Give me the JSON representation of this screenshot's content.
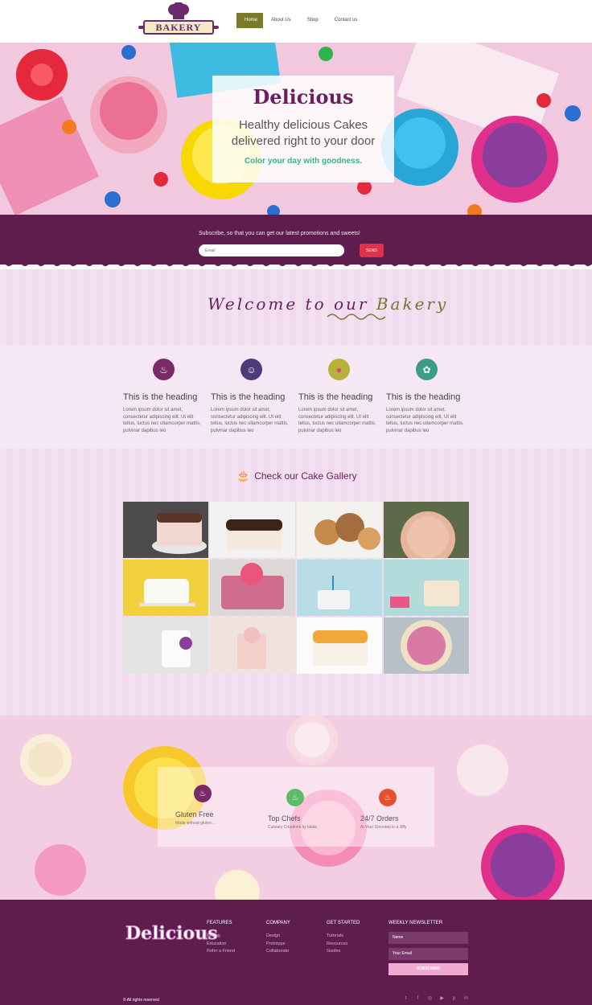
{
  "nav": {
    "logo_text": "BAKERY",
    "links": [
      "Home",
      "About Us",
      "Shop",
      "Contact us"
    ],
    "active": "Home"
  },
  "hero": {
    "brand": "Delicious",
    "headline_line1": "Healthy delicious Cakes",
    "headline_line2": "delivered right to your door",
    "tagline": "Color your day with goodness."
  },
  "subscribe": {
    "text": "Subscribe, so that you can get our latest promotions and sweets!",
    "placeholder": "Email",
    "button": "SEND"
  },
  "welcome": {
    "prefix": "Welcome to our",
    "emphasis": "Bakery"
  },
  "features": [
    {
      "heading": "This is the heading",
      "text": "Lorem ipsum dolor sit amet, consectetur adipiscing elit. Ut elit tellus, luctus nec ullamcorper mattis, pulvinar dapibus leo",
      "icon": "cupcake-icon"
    },
    {
      "heading": "This is the heading",
      "text": "Lorem ipsum dolor sit amet, consectetur adipiscing elit. Ut elit tellus, luctus nec ullamcorper mattis, pulvinar dapibus leo",
      "icon": "chef-icon"
    },
    {
      "heading": "This is the heading",
      "text": "Lorem ipsum dolor sit amet, consectetur adipiscing elit. Ut elit tellus, luctus nec ullamcorper mattis, pulvinar dapibus leo",
      "icon": "ice-cream-icon"
    },
    {
      "heading": "This is the heading",
      "text": "Lorem ipsum dolor sit amet, consectetur adipiscing elit. Ut elit tellus, luctus nec ullamcorper mattis, pulvinar dapibus leo",
      "icon": "bunny-icon"
    }
  ],
  "gallery": {
    "title": "Check our Cake Gallery",
    "icon": "birthday-cake-icon",
    "tiles": 12
  },
  "stats": [
    {
      "title": "Gluten Free",
      "subtitle": "Made without gluten...",
      "icon": "cupcake-icon"
    },
    {
      "title": "Top Chefs",
      "subtitle": "Culinary Creations by lalala",
      "icon": "cupcake-icon"
    },
    {
      "title": "24/7 Orders",
      "subtitle": "At Your Doorstep in a Jiffy",
      "icon": "cupcake-icon"
    }
  ],
  "footer": {
    "brand": "Delicious",
    "columns": [
      {
        "heading": "FEATURES",
        "links": [
          "Pricing",
          "Education",
          "Refer a Friend"
        ]
      },
      {
        "heading": "COMPANY",
        "links": [
          "Design",
          "Prototype",
          "Collaborate"
        ]
      },
      {
        "heading": "GET STARTED",
        "links": [
          "Tutorials",
          "Resources",
          "Guides"
        ]
      }
    ],
    "newsletter": {
      "heading": "WEEKLY NEWSLETTER",
      "name_placeholder": "Name",
      "email_placeholder": "Your Email",
      "button": "SUBSCRIBE"
    },
    "copyright": "© All rights reserved",
    "social_icons": [
      "twitter-icon",
      "facebook-icon",
      "dribbble-icon",
      "youtube-icon",
      "pinterest-icon",
      "linkedin-icon"
    ]
  },
  "colors": {
    "primary": "#5e1c4f",
    "accent_olive": "#7b7a2a",
    "send_red": "#e0304c",
    "tagline_green": "#3bae8c"
  }
}
